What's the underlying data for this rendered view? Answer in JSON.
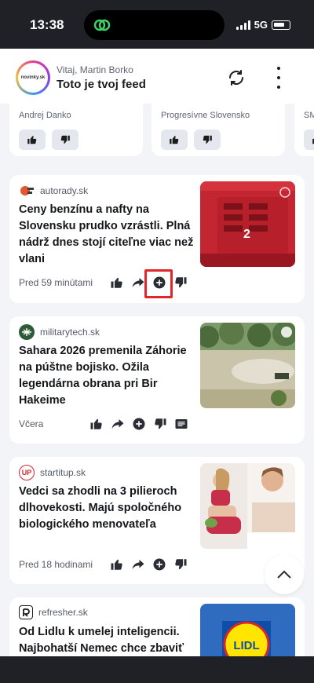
{
  "status": {
    "time": "13:38",
    "network": "5G"
  },
  "header": {
    "logo_text": "novinky.sk",
    "greeting": "Vitaj, Martin Borko",
    "title": "Toto je tvoj feed"
  },
  "politicians": [
    {
      "name": "Andrej Danko"
    },
    {
      "name": "Progresívne Slovensko"
    },
    {
      "name": "SM"
    }
  ],
  "articles": [
    {
      "source": "autorady.sk",
      "headline": "Ceny benzínu a nafty na Slovensku prudko vzrástli. Plná nádrž dnes stojí citeľne viac než vlani",
      "time": "Pred 59 minútami"
    },
    {
      "source": "militarytech.sk",
      "headline": "Sahara 2026 premenila Záhorie na púštne bojisko. Ožila legendárna obrana pri Bir Hakeime",
      "time": "Včera"
    },
    {
      "source": "startitup.sk",
      "source_icon_text": "UP",
      "headline": "Vedci sa zhodli na 3 pilieroch dlhovekosti. Majú spoločného biologického menovateľa",
      "time": "Pred 18 hodinami"
    },
    {
      "source": "refresher.sk",
      "headline": "Od Lidlu k umelej inteligencii. Najbohatší Nemec chce zbaviť",
      "thumb_text": "LIDL"
    }
  ],
  "colors": {
    "highlight": "#e0262b",
    "card": "#ffffff",
    "background": "#f3f4f7"
  }
}
